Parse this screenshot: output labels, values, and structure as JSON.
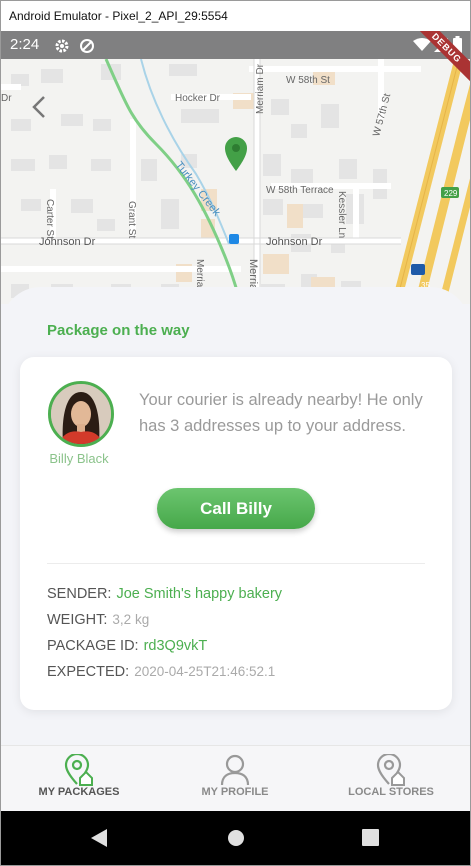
{
  "window": {
    "title": "Android Emulator - Pixel_2_API_29:5554"
  },
  "status_bar": {
    "time": "2:24",
    "debug_label": "DEBUG"
  },
  "map": {
    "streets": {
      "w58": "W 58th St",
      "hocker": "Hocker Dr",
      "w58terrace": "W 58th Terrace",
      "johnson_left": "Johnson Dr",
      "johnson_right": "Johnson Dr",
      "merriam_top": "Merriam Dr",
      "merriam_bottom_1": "Merriam",
      "merriam_bottom_2": "Merria",
      "turkey": "Turkey Creek",
      "carter": "Carter St",
      "grant": "Grant St",
      "kessler": "Kessler Ln",
      "w57": "W 57th St",
      "hw229": "229",
      "hw35": "35",
      "dr": "Dr"
    }
  },
  "sheet": {
    "title": "Package on the way"
  },
  "courier": {
    "name": "Billy Black",
    "message": "Your courier is already nearby! He only has 3 addresses up to your address.",
    "call_button": "Call Billy"
  },
  "details": {
    "sender_label": "SENDER:",
    "sender_value": "Joe Smith's happy bakery",
    "weight_label": "WEIGHT:",
    "weight_value": "3,2 kg",
    "package_label": "PACKAGE ID:",
    "package_value": "rd3Q9vkT",
    "expected_label": "EXPECTED:",
    "expected_value": "2020-04-25T21:46:52.1"
  },
  "bottom_nav": [
    {
      "label": "MY PACKAGES",
      "icon": "location-package-icon",
      "active": true
    },
    {
      "label": "MY PROFILE",
      "icon": "person-icon",
      "active": false
    },
    {
      "label": "LOCAL STORES",
      "icon": "location-store-icon",
      "active": false
    }
  ],
  "colors": {
    "accent": "#4caf50",
    "inactive": "#8a8a8a",
    "sheet": "#f3f4f8"
  }
}
